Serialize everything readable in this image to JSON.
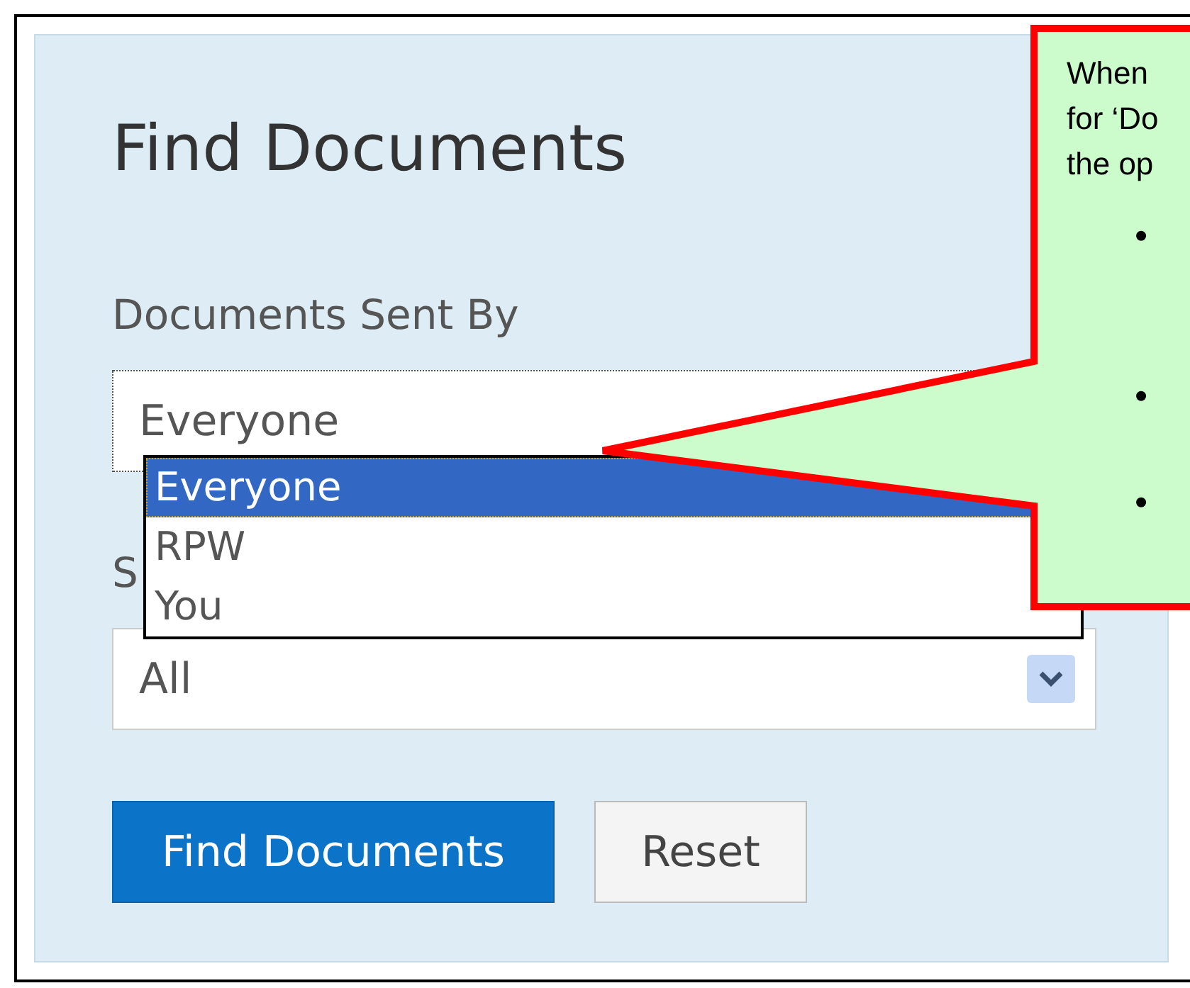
{
  "form": {
    "title": "Find Documents",
    "fields": [
      {
        "label": "Documents Sent By",
        "value": "Everyone",
        "focused": true,
        "options": [
          {
            "label": "Everyone",
            "selected": true
          },
          {
            "label": "RPW",
            "selected": false
          },
          {
            "label": "You",
            "selected": false
          }
        ]
      },
      {
        "label": "S",
        "value": "All",
        "focused": false
      }
    ],
    "buttons": [
      {
        "label": "Find Documents",
        "kind": "primary"
      },
      {
        "label": "Reset",
        "kind": "secondary"
      }
    ]
  },
  "callout": {
    "lines": [
      "When",
      "for ‘Do",
      "the op"
    ],
    "bullets": [
      "•",
      "•",
      "•"
    ]
  }
}
